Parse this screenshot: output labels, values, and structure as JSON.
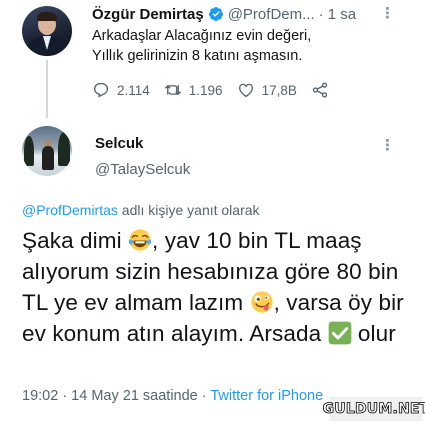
{
  "quoted_tweet": {
    "author_name": "Özgür Demirtaş",
    "author_handle": "@ProfDem...",
    "time_ago": "· 1 sa",
    "text_line1": "Arkadaşlar Alacağınız evin değeri,",
    "text_line2": "Yıllık gelirinizin 8 katını aşmasın.",
    "reply_count": "2.114",
    "retweet_count": "1.196",
    "like_count": "17,8B",
    "icons": [
      "reply-icon",
      "retweet-icon",
      "like-icon",
      "share-icon",
      "verified-icon",
      "more-icon"
    ]
  },
  "reply_tweet": {
    "author_name": "Selcuk",
    "author_handle": "@TalaySelcuk",
    "replying_mention": "@ProfDemirtas",
    "replying_suffix": " adlı kişiye yanıt olarak",
    "text_part1": "Şaka dimi ",
    "text_part2": ", yav 10 bin TL maaş alıyorum sizin hesabınıza göre 80 bin TL ye ev almam lazım ",
    "text_part3": ", varsa öy bir ev konum atın alayım. Arsada ",
    "text_part4": " olur",
    "emojis": [
      "tears-of-joy-emoji",
      "zany-face-emoji",
      "check-mark-emoji"
    ],
    "timestamp": "19:02 · 14 May 21 saatinde · ",
    "source": "Twitter for iPhone"
  },
  "watermark": "GULDUM.NET",
  "colors": {
    "link": "#1d9bf0",
    "secondary_text": "#536471",
    "verified": "#1d9bf0"
  }
}
